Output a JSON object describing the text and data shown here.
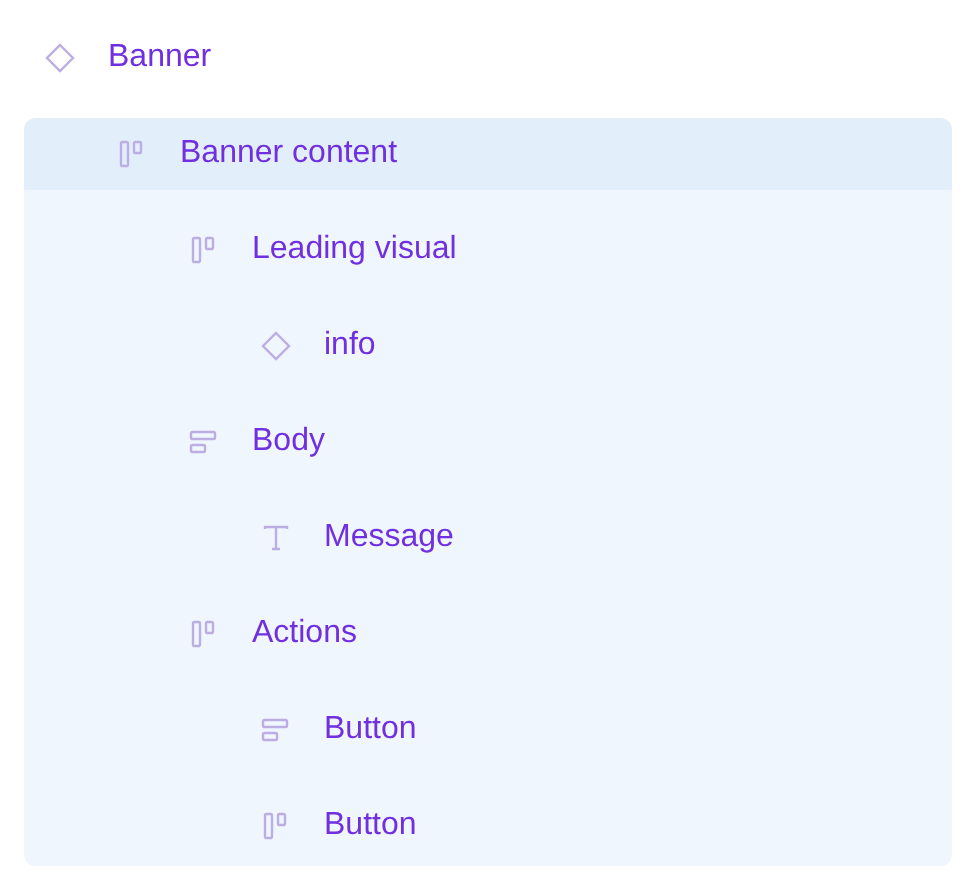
{
  "layers": [
    {
      "name": "Banner",
      "kind": "component",
      "selected": false,
      "children": [
        {
          "name": "Banner content",
          "kind": "hstack",
          "selected": true,
          "children": [
            {
              "name": "Leading visual",
              "kind": "hstack",
              "selected": false,
              "children": [
                {
                  "name": "info",
                  "kind": "component",
                  "selected": false
                }
              ]
            },
            {
              "name": "Body",
              "kind": "vstack",
              "selected": false,
              "children": [
                {
                  "name": "Message",
                  "kind": "text",
                  "selected": false
                }
              ]
            },
            {
              "name": "Actions",
              "kind": "hstack",
              "selected": false,
              "children": [
                {
                  "name": "Button",
                  "kind": "vstack",
                  "selected": false
                },
                {
                  "name": "Button",
                  "kind": "hstack",
                  "selected": false
                }
              ]
            }
          ]
        }
      ]
    }
  ]
}
